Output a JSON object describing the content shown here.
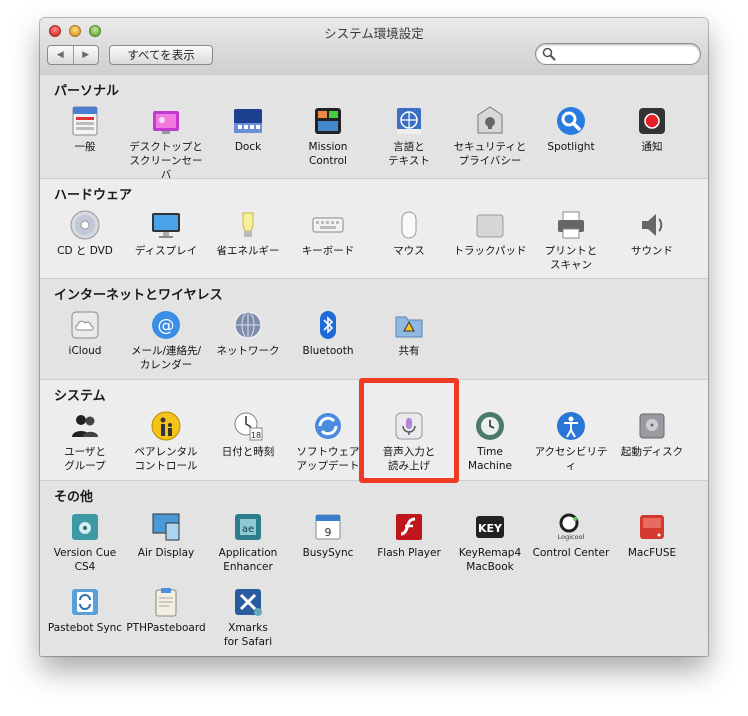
{
  "window": {
    "title": "システム環境設定"
  },
  "toolbar": {
    "back": "◀",
    "forward": "▶",
    "show_all": "すべてを表示",
    "search_value": ""
  },
  "colors": {
    "highlight": "#f03b22"
  },
  "sections": [
    {
      "title": "パーソナル",
      "items": [
        {
          "label": "一般",
          "icon": "general-icon"
        },
        {
          "label": "デスクトップと\nスクリーンセーバ",
          "icon": "desktop-screensaver-icon"
        },
        {
          "label": "Dock",
          "icon": "dock-icon"
        },
        {
          "label": "Mission\nControl",
          "icon": "mission-control-icon"
        },
        {
          "label": "言語と\nテキスト",
          "icon": "language-text-icon"
        },
        {
          "label": "セキュリティと\nプライバシー",
          "icon": "security-privacy-icon"
        },
        {
          "label": "Spotlight",
          "icon": "spotlight-icon"
        },
        {
          "label": "通知",
          "icon": "notifications-icon"
        }
      ]
    },
    {
      "title": "ハードウェア",
      "items": [
        {
          "label": "CD と DVD",
          "icon": "cd-dvd-icon"
        },
        {
          "label": "ディスプレイ",
          "icon": "display-icon"
        },
        {
          "label": "省エネルギー",
          "icon": "energy-saver-icon"
        },
        {
          "label": "キーボード",
          "icon": "keyboard-icon"
        },
        {
          "label": "マウス",
          "icon": "mouse-icon"
        },
        {
          "label": "トラックパッド",
          "icon": "trackpad-icon"
        },
        {
          "label": "プリントと\nスキャン",
          "icon": "print-scan-icon"
        },
        {
          "label": "サウンド",
          "icon": "sound-icon"
        }
      ]
    },
    {
      "title": "インターネットとワイヤレス",
      "items": [
        {
          "label": "iCloud",
          "icon": "icloud-icon"
        },
        {
          "label": "メール/連絡先/\nカレンダー",
          "icon": "mail-contacts-calendar-icon"
        },
        {
          "label": "ネットワーク",
          "icon": "network-icon"
        },
        {
          "label": "Bluetooth",
          "icon": "bluetooth-icon"
        },
        {
          "label": "共有",
          "icon": "sharing-icon"
        }
      ]
    },
    {
      "title": "システム",
      "items": [
        {
          "label": "ユーザと\nグループ",
          "icon": "users-groups-icon"
        },
        {
          "label": "ペアレンタル\nコントロール",
          "icon": "parental-controls-icon"
        },
        {
          "label": "日付と時刻",
          "icon": "date-time-icon"
        },
        {
          "label": "ソフトウェア\nアップデート",
          "icon": "software-update-icon"
        },
        {
          "label": "音声入力と\n読み上げ",
          "icon": "dictation-speech-icon"
        },
        {
          "label": "Time\nMachine",
          "icon": "time-machine-icon"
        },
        {
          "label": "アクセシビリティ",
          "icon": "accessibility-icon"
        },
        {
          "label": "起動ディスク",
          "icon": "startup-disk-icon"
        }
      ]
    },
    {
      "title": "その他",
      "items": [
        {
          "label": "Version Cue\nCS4",
          "icon": "version-cue-icon"
        },
        {
          "label": "Air Display",
          "icon": "air-display-icon"
        },
        {
          "label": "Application\nEnhancer",
          "icon": "application-enhancer-icon"
        },
        {
          "label": "BusySync",
          "icon": "busysync-icon"
        },
        {
          "label": "Flash Player",
          "icon": "flash-player-icon"
        },
        {
          "label": "KeyRemap4\nMacBook",
          "icon": "keyremap-icon"
        },
        {
          "label": "Control Center",
          "icon": "logicool-control-center-icon"
        },
        {
          "label": "MacFUSE",
          "icon": "macfuse-icon"
        },
        {
          "label": "Pastebot Sync",
          "icon": "pastebot-sync-icon"
        },
        {
          "label": "PTHPasteboard",
          "icon": "pthpasteboard-icon"
        },
        {
          "label": "Xmarks\nfor Safari",
          "icon": "xmarks-icon"
        }
      ]
    }
  ],
  "icon_texts": {
    "keyremap": "KEY",
    "logicool": "Logicool",
    "general": "File\nNew\nOpe"
  }
}
